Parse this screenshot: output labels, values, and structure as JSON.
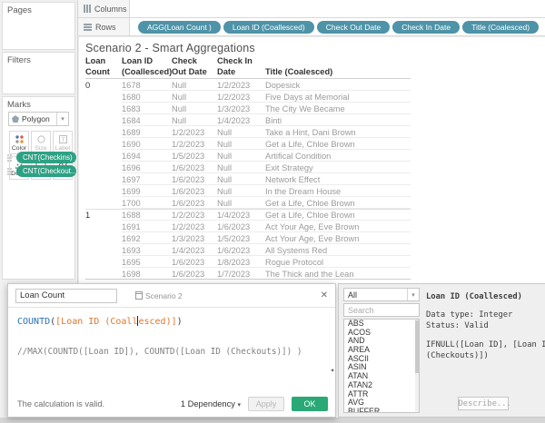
{
  "app": {
    "accent_teal": "#4e93a8",
    "accent_green": "#2ea184",
    "ok_green": "#2aa876"
  },
  "shelves": {
    "columns_label": "Columns",
    "rows_label": "Rows",
    "rows_pills": [
      "AGG(Loan Count )",
      "Loan ID (Coallesced)",
      "Check Out Date",
      "Check In Date",
      "Title (Coalesced)"
    ]
  },
  "sidebar": {
    "pages_label": "Pages",
    "filters_label": "Filters",
    "marks": {
      "label": "Marks",
      "mark_type": "Polygon",
      "buttons": [
        "Color",
        "Size",
        "Label",
        "Detail",
        "Tooltip",
        "Path"
      ],
      "pills": [
        "CNT(Checkins)",
        "CNT(Checkout.."
      ]
    }
  },
  "sheet": {
    "title": "Scenario 2 - Smart Aggregations",
    "table": {
      "headers": [
        "Loan Count",
        "Loan ID (Coallesced)",
        "Check Out Date",
        "Check In Date",
        "Title (Coalesced)"
      ],
      "rows": [
        {
          "group_start": false,
          "cells": [
            "0",
            "1678",
            "Null",
            "1/2/2023",
            "Dopesick"
          ]
        },
        {
          "group_start": false,
          "cells": [
            "",
            "1680",
            "Null",
            "1/2/2023",
            "Five Days at Memorial"
          ]
        },
        {
          "group_start": false,
          "cells": [
            "",
            "1683",
            "Null",
            "1/3/2023",
            "The City We Became"
          ]
        },
        {
          "group_start": false,
          "cells": [
            "",
            "1684",
            "Null",
            "1/4/2023",
            "Binti"
          ]
        },
        {
          "group_start": false,
          "cells": [
            "",
            "1689",
            "1/2/2023",
            "Null",
            "Take a Hint, Dani Brown"
          ]
        },
        {
          "group_start": false,
          "cells": [
            "",
            "1690",
            "1/2/2023",
            "Null",
            "Get a Life, Chloe Brown"
          ]
        },
        {
          "group_start": false,
          "cells": [
            "",
            "1694",
            "1/5/2023",
            "Null",
            "Artifical Condition"
          ]
        },
        {
          "group_start": false,
          "cells": [
            "",
            "1696",
            "1/6/2023",
            "Null",
            "Exit Strategy"
          ]
        },
        {
          "group_start": false,
          "cells": [
            "",
            "1697",
            "1/6/2023",
            "Null",
            "Network Effect"
          ]
        },
        {
          "group_start": false,
          "cells": [
            "",
            "1699",
            "1/6/2023",
            "Null",
            "In the Dream House"
          ]
        },
        {
          "group_start": false,
          "cells": [
            "",
            "1700",
            "1/6/2023",
            "Null",
            "Get a Life, Chloe Brown"
          ]
        },
        {
          "group_start": true,
          "cells": [
            "1",
            "1688",
            "1/2/2023",
            "1/4/2023",
            "Get a Life, Chloe Brown"
          ]
        },
        {
          "group_start": false,
          "cells": [
            "",
            "1691",
            "1/2/2023",
            "1/6/2023",
            "Act Your Age, Eve Brown"
          ]
        },
        {
          "group_start": false,
          "cells": [
            "",
            "1692",
            "1/3/2023",
            "1/5/2023",
            "Act Your Age, Eve Brown"
          ]
        },
        {
          "group_start": false,
          "cells": [
            "",
            "1693",
            "1/4/2023",
            "1/6/2023",
            "All Systems Red"
          ]
        },
        {
          "group_start": false,
          "cells": [
            "",
            "1695",
            "1/6/2023",
            "1/8/2023",
            "Rogue Protocol"
          ]
        },
        {
          "group_start": false,
          "cells": [
            "",
            "1698",
            "1/6/2023",
            "1/7/2023",
            "The Thick and the Lean"
          ]
        }
      ]
    }
  },
  "calc_editor": {
    "name_value": "Loan Count",
    "sheet_ref": "Scenario 2",
    "formula": {
      "function_token": "COUNTD",
      "paren_open": "(",
      "field_before_cursor": "[Loan ID (Coall",
      "field_after_cursor": "esced)]",
      "paren_close": ")"
    },
    "comment": "//MAX(COUNTD([Loan ID]), COUNTD([Loan ID (Checkouts)]) )",
    "status": "The calculation is valid.",
    "dependency_label": "1 Dependency",
    "apply_label": "Apply",
    "ok_label": "OK"
  },
  "functions_panel": {
    "category_selected": "All",
    "search_placeholder": "Search",
    "functions": [
      "ABS",
      "ACOS",
      "AND",
      "AREA",
      "ASCII",
      "ASIN",
      "ATAN",
      "ATAN2",
      "ATTR",
      "AVG",
      "BUFFER"
    ],
    "field_info": {
      "title": "Loan ID (Coallesced)",
      "data_type": "Data type: Integer",
      "status": "Status: Valid",
      "formula_line1": "IFNULL([Loan ID], [Loan ID",
      "formula_line2": "(Checkouts)])",
      "describe_label": "Describe..."
    }
  }
}
